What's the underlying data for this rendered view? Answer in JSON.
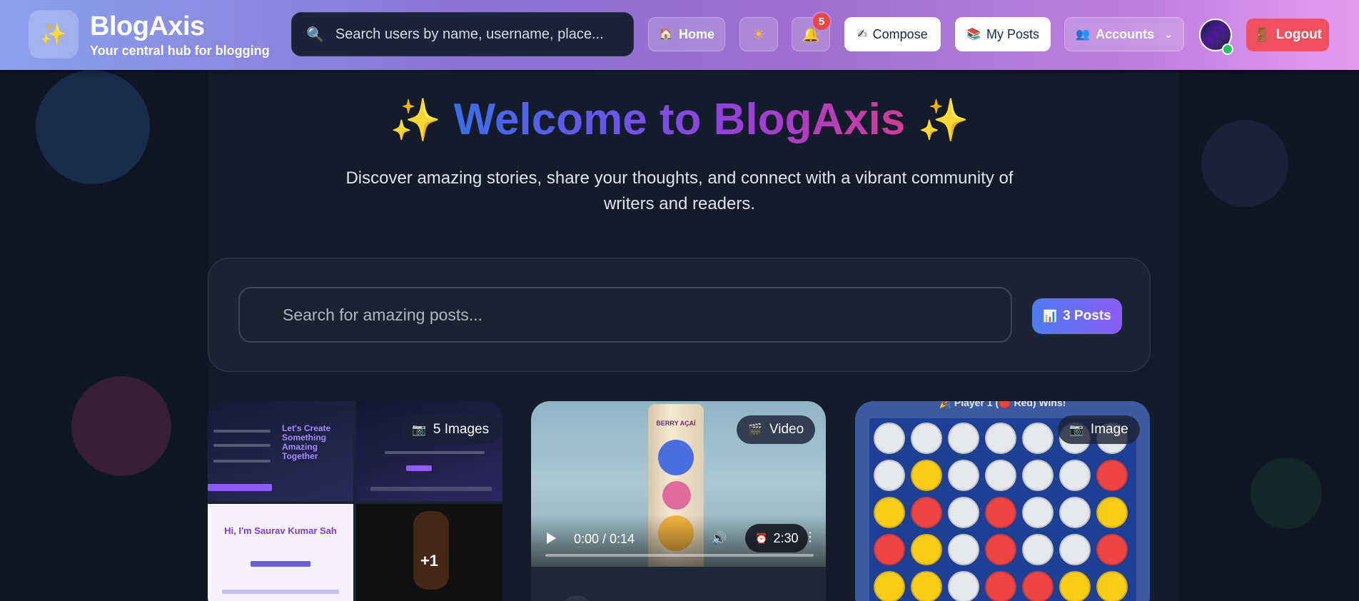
{
  "header": {
    "logo_icon": "sparkles-icon",
    "brand": "BlogAxis",
    "tagline": "Your central hub for blogging",
    "search_placeholder": "Search users by name, username, place...",
    "home_label": "Home",
    "notifications_count": "5",
    "compose_label": "Compose",
    "my_posts_label": "My Posts",
    "accounts_label": "Accounts",
    "logout_label": "Logout"
  },
  "hero": {
    "sparkle_left": "✨",
    "title_text": "Welcome to BlogAxis",
    "sparkle_right": "✨",
    "subtitle": "Discover amazing stories, share your thoughts, and connect with a vibrant community of writers and readers."
  },
  "post_search": {
    "placeholder": "Search for amazing posts...",
    "count_label": "3 Posts"
  },
  "cards": [
    {
      "media_type_label": "5 Images",
      "more_count": "+1",
      "tile1_heading": "Let's Create Something Amazing Together",
      "tile3_heading": "Hi, I'm Saurav Kumar Sah"
    },
    {
      "media_type_label": "Video",
      "time": "0:00 / 0:14",
      "duration": "2:30",
      "can_text": "BERRY AÇAÍ"
    },
    {
      "media_type_label": "Image",
      "winner_text": "🎉 Player 1 (🔴 Red) Wins!"
    }
  ],
  "colors": {
    "accent_blue": "#3b6de8",
    "accent_purple": "#9b3fd6",
    "accent_pink": "#d23c99",
    "logout_red": "#ef4f5e",
    "online_green": "#22c55e"
  }
}
